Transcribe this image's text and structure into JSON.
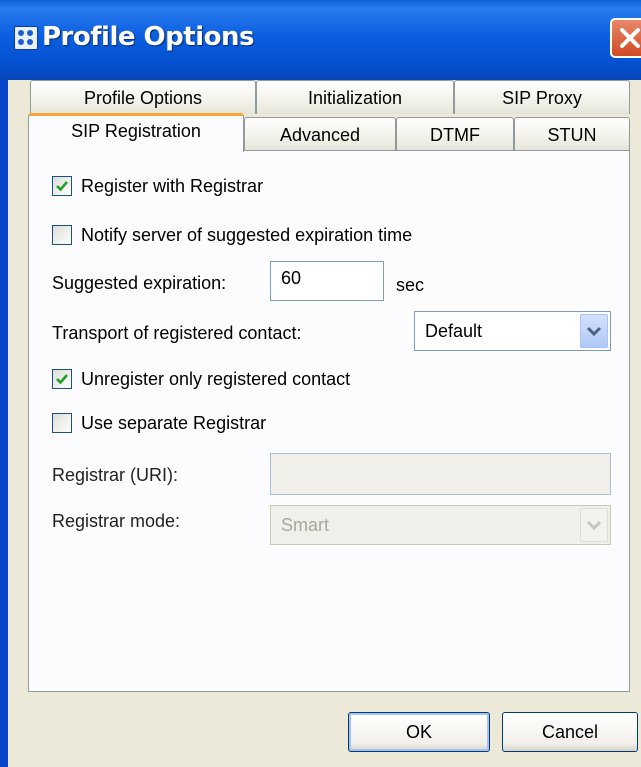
{
  "window": {
    "title": "Profile Options"
  },
  "tabs": {
    "row1": [
      "Profile Options",
      "Initialization",
      "SIP Proxy"
    ],
    "row2": [
      "SIP Registration",
      "Advanced",
      "DTMF",
      "STUN"
    ],
    "active": "SIP Registration"
  },
  "form": {
    "register_with_registrar": {
      "label": "Register with Registrar",
      "checked": true
    },
    "notify_server": {
      "label": "Notify server of suggested expiration time",
      "checked": false
    },
    "suggested_expiration": {
      "label": "Suggested expiration:",
      "value": "60",
      "unit": "sec"
    },
    "transport": {
      "label": "Transport of registered contact:",
      "value": "Default"
    },
    "unregister_only": {
      "label": "Unregister only registered contact",
      "checked": true
    },
    "use_separate_registrar": {
      "label": "Use separate Registrar",
      "checked": false
    },
    "registrar_uri": {
      "label": "Registrar (URI):",
      "value": ""
    },
    "registrar_mode": {
      "label": "Registrar mode:",
      "value": "Smart"
    }
  },
  "buttons": {
    "ok": "OK",
    "cancel": "Cancel"
  },
  "colors": {
    "titlebar": "#0A5FD8",
    "dialog_bg": "#ECE9D8",
    "check": "#21A121",
    "active_tab_accent": "#F6A83A"
  }
}
